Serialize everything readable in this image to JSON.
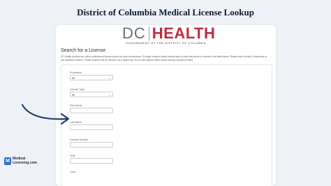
{
  "page": {
    "heading": "District of Columbia Medical License Lookup"
  },
  "logo": {
    "dc": "DC",
    "health": "HEALTH",
    "subtitle": "GOVERNMENT OF THE DISTRICT OF COLUMBIA"
  },
  "search": {
    "title": "Search for a License",
    "intro": "DC Health provides an online professional license search for your convenience. To begin a search select license type or enter key words or criteria in the fields below. Please enter at least 3 characters or use Advanced Search. Partial matches will be returned. As a search tip: Do not use dashes within social security numbers (SSNs)."
  },
  "form": {
    "profession_label": "Profession",
    "profession_value": "All",
    "license_type_label": "License Type",
    "license_type_value": "All",
    "first_name_label": "First Name",
    "first_name_value": "",
    "last_name_label": "Last Name",
    "last_name_value": "",
    "license_number_label": "License Number",
    "license_number_value": "",
    "ssn_label": "SSN",
    "ssn_value": "",
    "next_label": "Clinic"
  },
  "brand": {
    "icon_letter": "M",
    "line1": "Medical",
    "line2": "Licensing.com"
  },
  "colors": {
    "health_red": "#bf2d3a",
    "arrow": "#1f3b6e",
    "brand_blue": "#2f6fd6"
  }
}
